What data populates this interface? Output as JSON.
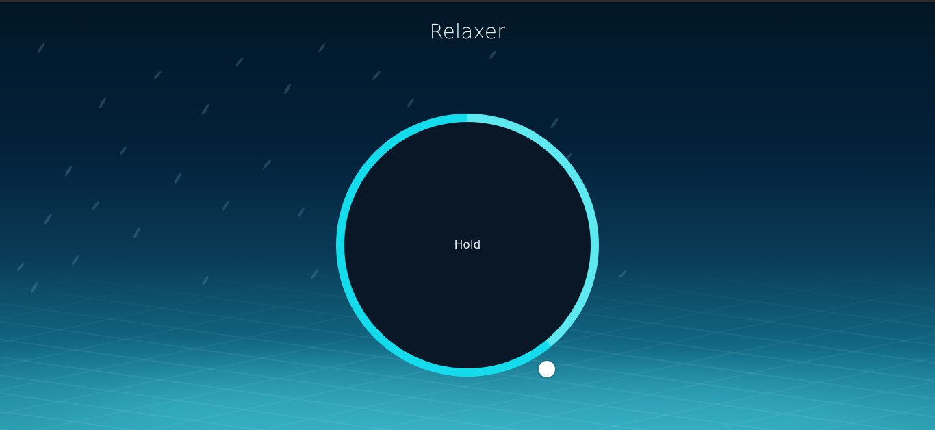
{
  "app": {
    "title": "Relaxer"
  },
  "breathing": {
    "status_text": "Hold",
    "progress_fraction": 0.39
  },
  "colors": {
    "ring_primary": "#14dcec",
    "ring_secondary": "#5ee8ef",
    "circle_fill": "#0a1726",
    "pointer": "#ffffff",
    "title_text": "#f2f5f7"
  },
  "icons": {
    "pointer": "progress-pointer-dot"
  }
}
